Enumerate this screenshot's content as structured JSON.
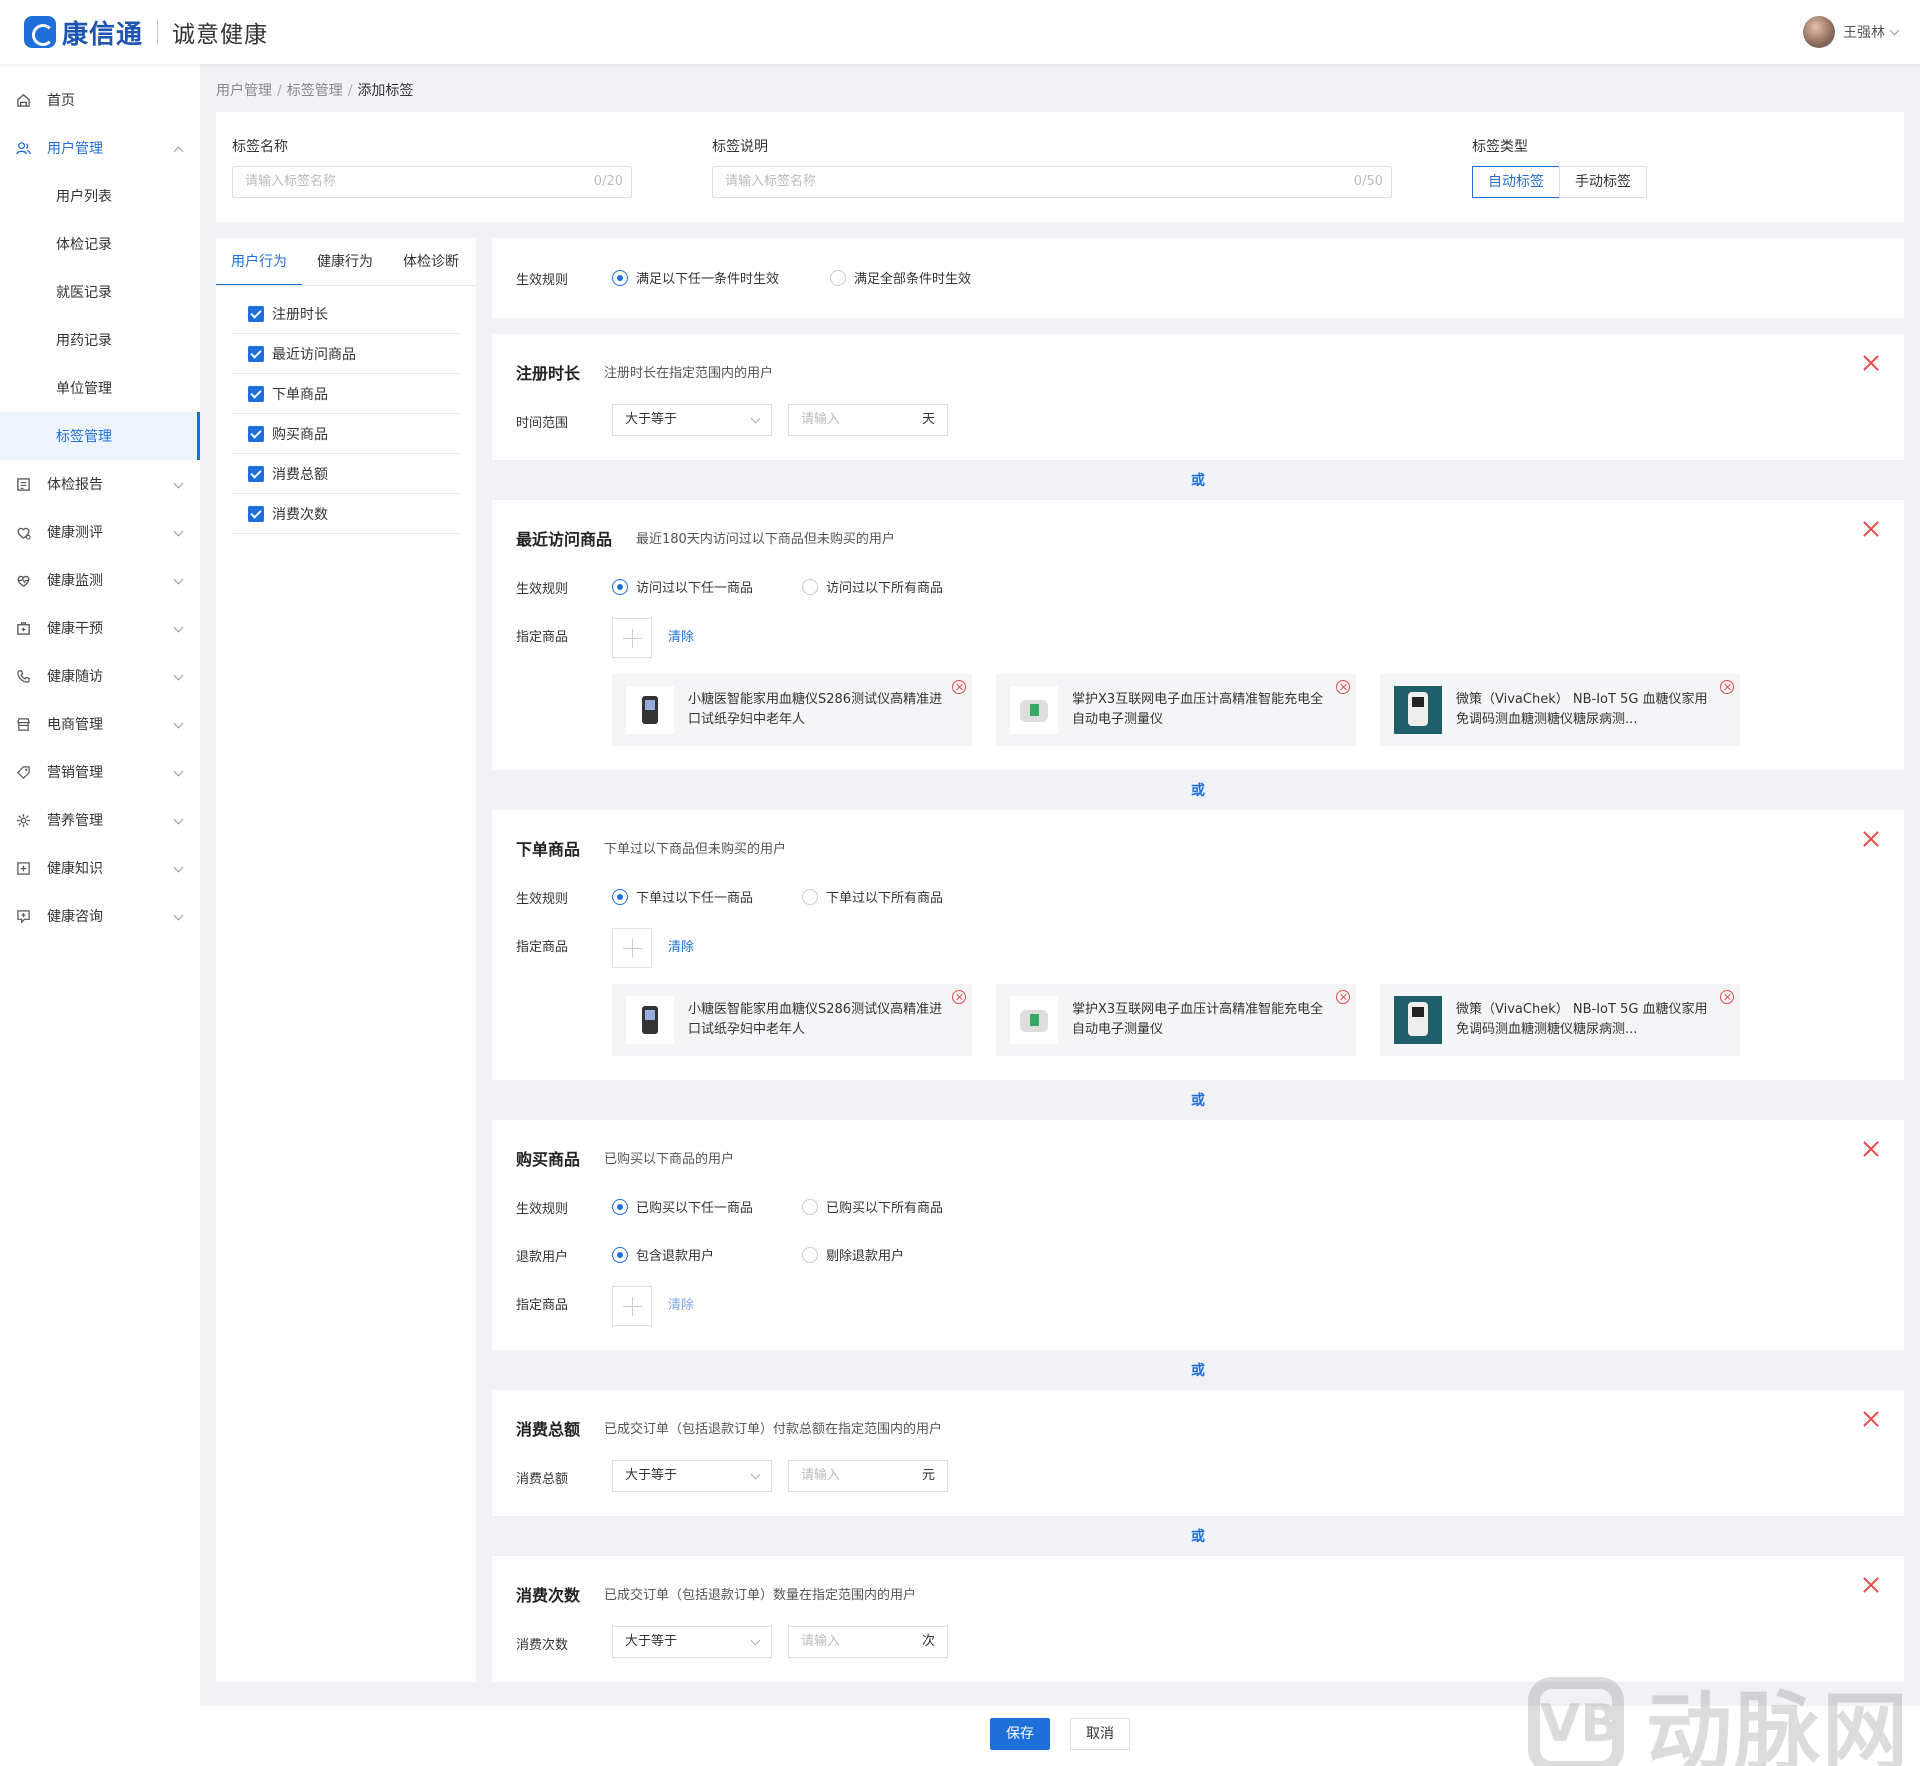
{
  "header": {
    "logo_text": "康信通",
    "org_name": "诚意健康",
    "user_name": "王强林"
  },
  "sidebar": {
    "items": [
      {
        "label": "首页",
        "icon": "home-icon"
      },
      {
        "label": "用户管理",
        "icon": "users-icon",
        "expanded": true,
        "children": [
          "用户列表",
          "体检记录",
          "就医记录",
          "用药记录",
          "单位管理",
          "标签管理"
        ],
        "active_child": "标签管理"
      },
      {
        "label": "体检报告",
        "icon": "report-icon"
      },
      {
        "label": "健康测评",
        "icon": "evaluate-icon"
      },
      {
        "label": "健康监测",
        "icon": "heart-pulse-icon"
      },
      {
        "label": "健康干预",
        "icon": "medkit-icon"
      },
      {
        "label": "健康随访",
        "icon": "phone-icon"
      },
      {
        "label": "电商管理",
        "icon": "store-icon"
      },
      {
        "label": "营销管理",
        "icon": "tag-icon"
      },
      {
        "label": "营养管理",
        "icon": "nutrition-icon"
      },
      {
        "label": "健康知识",
        "icon": "knowledge-icon"
      },
      {
        "label": "健康咨询",
        "icon": "consult-icon"
      }
    ]
  },
  "breadcrumb": [
    "用户管理",
    "标签管理",
    "添加标签"
  ],
  "form": {
    "name_label": "标签名称",
    "name_placeholder": "请输入标签名称",
    "name_count": "0/20",
    "desc_label": "标签说明",
    "desc_placeholder": "请输入标签名称",
    "desc_count": "0/50",
    "type_label": "标签类型",
    "type_options": [
      "自动标签",
      "手动标签"
    ],
    "type_selected": "自动标签"
  },
  "left_panel": {
    "tabs": [
      "用户行为",
      "健康行为",
      "体检诊断"
    ],
    "active_tab": "用户行为",
    "checks": [
      "注册时长",
      "最近访问商品",
      "下单商品",
      "购买商品",
      "消费总额",
      "消费次数"
    ]
  },
  "rule": {
    "label": "生效规则",
    "options": [
      "满足以下任一条件时生效",
      "满足全部条件时生效"
    ],
    "selected": 0
  },
  "or_text": "或",
  "products": [
    {
      "name": "小糖医智能家用血糖仪S286测试仪高精准进口试纸孕妇中老年人",
      "icon": "glucose-meter-icon"
    },
    {
      "name": "掌护X3互联网电子血压计高精准智能充电全自动电子测量仪",
      "icon": "blood-pressure-monitor-icon"
    },
    {
      "name": "微策（VivaChek） NB-IoT 5G 血糖仪家用免调码测血糖测糖仪糖尿病测...",
      "icon": "glucose-kit-icon"
    }
  ],
  "conditions": {
    "reg": {
      "title": "注册时长",
      "desc": "注册时长在指定范围内的用户",
      "field_label": "时间范围",
      "compare": "大于等于",
      "placeholder": "请输入",
      "unit": "天"
    },
    "visit": {
      "title": "最近访问商品",
      "desc": "最近180天内访问过以下商品但未购买的用户",
      "rule_label": "生效规则",
      "options": [
        "访问过以下任一商品",
        "访问过以下所有商品"
      ],
      "goods_label": "指定商品",
      "clear": "清除"
    },
    "order": {
      "title": "下单商品",
      "desc": "下单过以下商品但未购买的用户",
      "rule_label": "生效规则",
      "options": [
        "下单过以下任一商品",
        "下单过以下所有商品"
      ],
      "goods_label": "指定商品",
      "clear": "清除"
    },
    "purchase": {
      "title": "购买商品",
      "desc": "已购买以下商品的用户",
      "rule_label": "生效规则",
      "options": [
        "已购买以下任一商品",
        "已购买以下所有商品"
      ],
      "refund_label": "退款用户",
      "refund_options": [
        "包含退款用户",
        "剔除退款用户"
      ],
      "goods_label": "指定商品",
      "clear": "清除"
    },
    "amount": {
      "title": "消费总额",
      "desc": "已成交订单（包括退款订单）付款总额在指定范围内的用户",
      "field_label": "消费总额",
      "compare": "大于等于",
      "placeholder": "请输入",
      "unit": "元"
    },
    "count": {
      "title": "消费次数",
      "desc": "已成交订单（包括退款订单）数量在指定范围内的用户",
      "field_label": "消费次数",
      "compare": "大于等于",
      "placeholder": "请输入",
      "unit": "次"
    }
  },
  "footer": {
    "save": "保存",
    "cancel": "取消"
  },
  "watermark": {
    "mark": "VB",
    "text": "动脉网"
  },
  "colors": {
    "primary": "#1e6fd9",
    "danger": "#e64a4a"
  }
}
